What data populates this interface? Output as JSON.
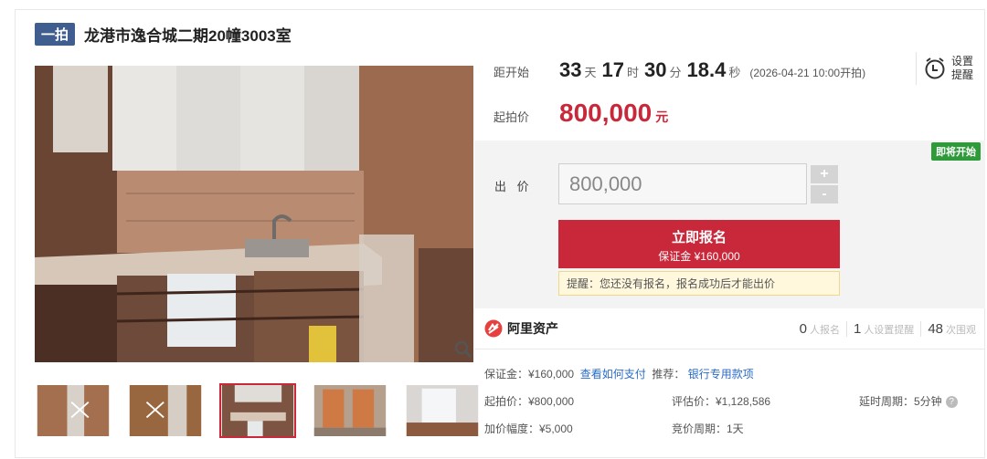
{
  "title": {
    "round_badge": "一拍",
    "lot_name": "龙港市逸合城二期20幢3003室"
  },
  "countdown": {
    "label": "距开始",
    "days": "33",
    "days_unit": "天",
    "hours": "17",
    "hours_unit": "时",
    "minutes": "30",
    "minutes_unit": "分",
    "seconds": "18.4",
    "seconds_unit": "秒",
    "start_note": "(2026-04-21 10:00开拍)"
  },
  "reminder": {
    "line1": "设置",
    "line2": "提醒",
    "icon": "alarm-clock-icon"
  },
  "start_price": {
    "label": "起拍价",
    "value": "800,000",
    "unit": "元"
  },
  "bid": {
    "status_badge": "即将开始",
    "label": "出 价",
    "input_value": "800,000",
    "plus": "+",
    "minus": "-",
    "signup_main": "立即报名",
    "signup_sub": "保证金 ¥160,000",
    "tip": "提醒：您还没有报名，报名成功后才能出价"
  },
  "platform": {
    "logo_text": "阿里资产"
  },
  "stats": [
    {
      "num": "0",
      "label": "人报名"
    },
    {
      "num": "1",
      "label": "人设置提醒"
    },
    {
      "num": "48",
      "label": "次围观"
    }
  ],
  "details": {
    "deposit": "保证金：¥160,000",
    "pay_link": "查看如何支付",
    "recommend_label": "推荐：",
    "recommend_link": "银行专用款项",
    "start_price": "起拍价：¥800,000",
    "estimate": "评估价：¥1,128,586",
    "delay": "延时周期：5分钟",
    "increment": "加价幅度：¥5,000",
    "cycle": "竞价周期：1天"
  },
  "colors": {
    "accent_red": "#c8283a",
    "badge_blue": "#3f5e8f",
    "status_green": "#2e9a3a",
    "link_blue": "#2a6bc5"
  }
}
